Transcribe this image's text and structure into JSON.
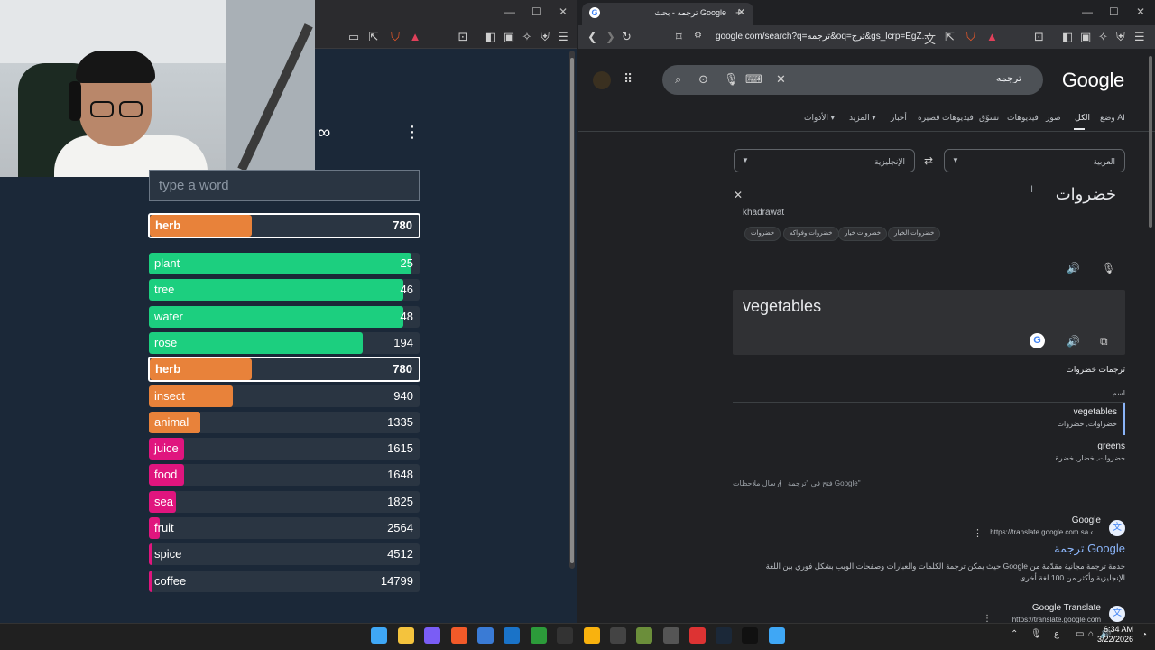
{
  "left_browser": {
    "window_controls": [
      "—",
      "☐",
      "✕"
    ]
  },
  "game": {
    "input_placeholder": "type a word",
    "highlight": {
      "word": "herb",
      "rank": "780",
      "fill": 0.38,
      "color": "#e8823a"
    },
    "guesses": [
      {
        "word": "plant",
        "rank": "25",
        "fill": 0.97,
        "color": "#1ccf7f"
      },
      {
        "word": "tree",
        "rank": "46",
        "fill": 0.94,
        "color": "#1ccf7f"
      },
      {
        "word": "water",
        "rank": "48",
        "fill": 0.94,
        "color": "#1ccf7f"
      },
      {
        "word": "rose",
        "rank": "194",
        "fill": 0.79,
        "color": "#1ccf7f"
      },
      {
        "word": "herb",
        "rank": "780",
        "fill": 0.38,
        "color": "#e8823a",
        "selected": true
      },
      {
        "word": "insect",
        "rank": "940",
        "fill": 0.31,
        "color": "#e8823a"
      },
      {
        "word": "animal",
        "rank": "1335",
        "fill": 0.19,
        "color": "#e8823a"
      },
      {
        "word": "juice",
        "rank": "1615",
        "fill": 0.13,
        "color": "#e0157e"
      },
      {
        "word": "food",
        "rank": "1648",
        "fill": 0.13,
        "color": "#e0157e"
      },
      {
        "word": "sea",
        "rank": "1825",
        "fill": 0.1,
        "color": "#e0157e"
      },
      {
        "word": "fruit",
        "rank": "2564",
        "fill": 0.04,
        "color": "#e0157e"
      },
      {
        "word": "spice",
        "rank": "4512",
        "fill": 0.01,
        "color": "#e0157e"
      },
      {
        "word": "coffee",
        "rank": "14799",
        "fill": 0.01,
        "color": "#e0157e"
      }
    ]
  },
  "right_browser": {
    "tab_title": "ترجمه - بحث Google",
    "url": "google.com/search?q=ترجمه&oq=ترج&gs_lcrp=EgZ...",
    "window_controls": [
      "—",
      "☐",
      "✕"
    ]
  },
  "google": {
    "logo": "Google",
    "query": "ترجمه",
    "tabs": [
      "وضع AI",
      "الكل",
      "صور",
      "فيديوهات",
      "تسوّق",
      "فيديوهات قصيرة",
      "أخبار",
      "المزيد ▾",
      "الأدوات ▾"
    ],
    "source_lang": "العربية",
    "target_lang": "الإنجليزية",
    "source_text": "خضروات",
    "transliteration": "khadrawat",
    "chips": [
      "خضروات الخيار",
      "خضروات خيار",
      "خضروات وفواكه",
      "خضروات"
    ],
    "target_text": "vegetables",
    "translations_heading": "ترجمات خضروات",
    "pos_label": "اسم",
    "translations": [
      {
        "word": "vegetables",
        "synonyms": "خضراوات, خضروات"
      },
      {
        "word": "greens",
        "synonyms": "خضروات, خضار, خضرة"
      }
    ],
    "feedback": "إرسال ملاحظات",
    "open_in": "فتح في \"ترجمة Google\"",
    "result1": {
      "site": "Google",
      "url": "https://translate.google.com.sa ‹ ...",
      "title": "ترجمة Google",
      "snippet": "خدمة ترجمة مجانية مقدّمة من Google حيث يمكن ترجمة الكلمات والعبارات وصفحات الويب بشكل فوري بين اللغة الإنجليزية وأكثر من 100 لغة أخرى."
    },
    "result2": {
      "site": "Google Translate",
      "url": "https://translate.google.com"
    }
  },
  "taskbar": {
    "time": "6:34 AM",
    "date": "3/22/2026",
    "lang": "ع"
  }
}
